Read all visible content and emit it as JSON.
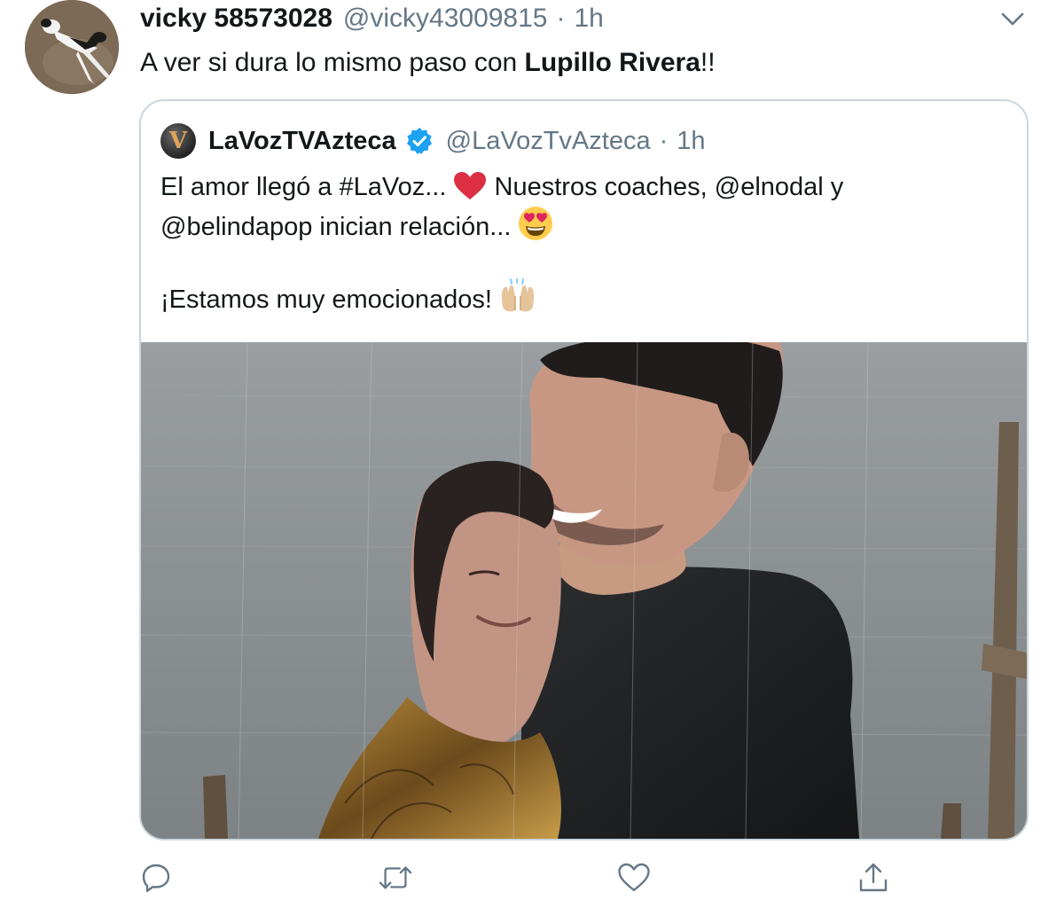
{
  "tweet": {
    "author": {
      "display_name": "vicky 58573028",
      "handle": "@vicky43009815",
      "time": "1h",
      "avatar_icon": "avatar-dog-photo"
    },
    "text_before": "A ver si dura lo mismo paso con ",
    "text_bold": "Lupillo Rivera",
    "text_after": "!!",
    "menu_icon": "chevron-down-icon"
  },
  "quoted": {
    "avatar_letter": "V",
    "display_name": "LaVozTVAzteca",
    "verified_icon": "verified-badge-icon",
    "handle": "@LaVozTvAzteca",
    "time": "1h",
    "line1": "El amor llegó a #LaVoz... ",
    "line1_after_heart": " Nuestros coaches, @elnodal y",
    "line2": "@belindapop inician relación... ",
    "line3": "¡Estamos muy emocionados! ",
    "media_description_icon": "photo-couple-in-rain"
  },
  "separator": "·",
  "actions": [
    {
      "name": "reply",
      "icon": "reply-icon"
    },
    {
      "name": "retweet",
      "icon": "retweet-icon"
    },
    {
      "name": "like",
      "icon": "heart-icon"
    },
    {
      "name": "share",
      "icon": "share-icon"
    }
  ],
  "colors": {
    "primary_text": "#14171a",
    "secondary_text": "#657786",
    "border": "#ccd6dd",
    "verified_blue": "#1da1f2",
    "heart_red": "#dd2e44"
  }
}
